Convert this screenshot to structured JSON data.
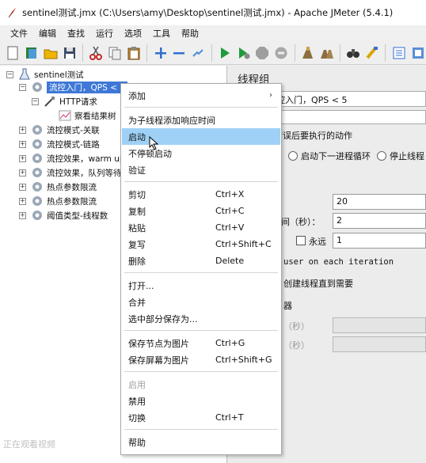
{
  "window": {
    "title": "sentinel测试.jmx (C:\\Users\\amy\\Desktop\\sentinel测试.jmx) - Apache JMeter (5.4.1)"
  },
  "menubar": [
    "文件",
    "编辑",
    "查找",
    "运行",
    "选项",
    "工具",
    "帮助"
  ],
  "toolbar": {
    "buttons": [
      "new-icon",
      "templates-icon",
      "open-icon",
      "save-icon",
      "cut-icon",
      "copy-icon",
      "paste-icon",
      "expand-icon",
      "collapse-icon",
      "toggle-icon",
      "start-icon",
      "start-no-pause-icon",
      "stop-icon",
      "shutdown-icon",
      "clear-icon",
      "clear-all-icon",
      "search-icon",
      "reset-search-icon",
      "function-helper-icon",
      "help-icon"
    ]
  },
  "tree": {
    "root": "sentinel测试",
    "selected": "流控入门，QPS < 5",
    "http_request": "HTTP请求",
    "listener": "察看结果树",
    "groups": [
      "流控模式-关联",
      "流控模式-链路",
      "流控效果，warm up",
      "流控效果，队列等待",
      "热点参数限流",
      "热点参数限流",
      "阈值类型-线程数"
    ]
  },
  "watermark": "正在观看视频",
  "right": {
    "heading": "线程组",
    "name_value": "控入门，QPS < 5",
    "error_action_label": "错误后要执行的动作",
    "radio_next_loop": "启动下一进程循环",
    "radio_stop_thread": "停止线程",
    "threads_value": "20",
    "rampup_label": "时间（秒）：",
    "rampup_value": "2",
    "forever_label": "永远",
    "loop_value": "1",
    "same_user_text": "user on each iteration",
    "delay_create_text": "创建线程直到需要",
    "scheduler_label": "器",
    "duration_label": "（秒）",
    "startup_delay_label": "（秒）"
  },
  "context_menu": {
    "items": [
      {
        "label": "添加",
        "shortcut": "",
        "submenu": true
      },
      {
        "label": "为子线程添加响应时间",
        "shortcut": ""
      },
      {
        "label": "启动",
        "shortcut": "",
        "highlighted": true
      },
      {
        "label": "不停顿启动",
        "shortcut": ""
      },
      {
        "label": "验证",
        "shortcut": ""
      },
      {
        "label": "剪切",
        "shortcut": "Ctrl+X"
      },
      {
        "label": "复制",
        "shortcut": "Ctrl+C"
      },
      {
        "label": "粘贴",
        "shortcut": "Ctrl+V"
      },
      {
        "label": "复写",
        "shortcut": "Ctrl+Shift+C"
      },
      {
        "label": "删除",
        "shortcut": "Delete"
      },
      {
        "label": "打开...",
        "shortcut": ""
      },
      {
        "label": "合并",
        "shortcut": ""
      },
      {
        "label": "选中部分保存为...",
        "shortcut": ""
      },
      {
        "label": "保存节点为图片",
        "shortcut": "Ctrl+G"
      },
      {
        "label": "保存屏幕为图片",
        "shortcut": "Ctrl+Shift+G"
      },
      {
        "label": "启用",
        "shortcut": "",
        "disabled": true
      },
      {
        "label": "禁用",
        "shortcut": ""
      },
      {
        "label": "切换",
        "shortcut": "Ctrl+T"
      },
      {
        "label": "帮助",
        "shortcut": ""
      }
    ]
  },
  "colors": {
    "selection": "#3f78d6",
    "menu_highlight": "#9fd1f7"
  }
}
